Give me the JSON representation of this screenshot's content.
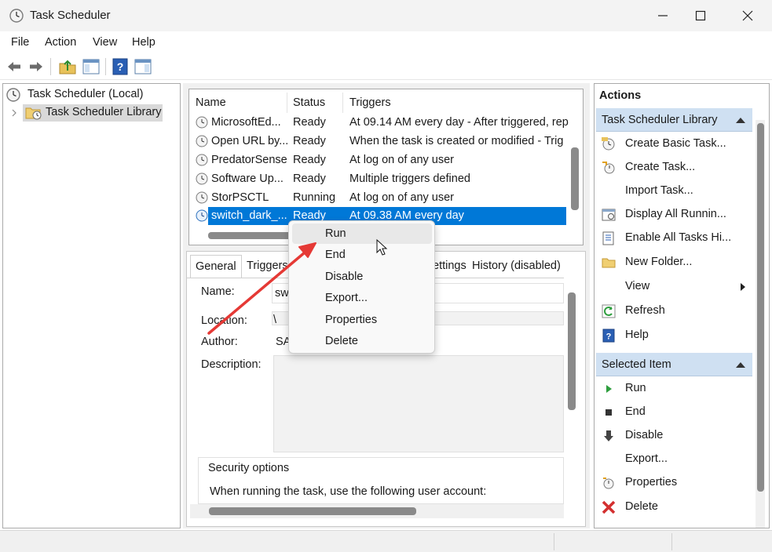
{
  "window": {
    "title": "Task Scheduler"
  },
  "menu": [
    "File",
    "Action",
    "View",
    "Help"
  ],
  "tree": {
    "root": "Task Scheduler (Local)",
    "child": "Task Scheduler Library"
  },
  "task_list": {
    "columns": [
      "Name",
      "Status",
      "Triggers"
    ],
    "rows": [
      {
        "name": "MicrosoftEd...",
        "status": "Ready",
        "trigger": "At 09.14 AM every day - After triggered, rep"
      },
      {
        "name": "Open URL by...",
        "status": "Ready",
        "trigger": "When the task is created or modified - Trig"
      },
      {
        "name": "PredatorSense",
        "status": "Ready",
        "trigger": "At log on of any user"
      },
      {
        "name": "Software Up...",
        "status": "Ready",
        "trigger": "Multiple triggers defined"
      },
      {
        "name": "StorPSCTL",
        "status": "Running",
        "trigger": "At log on of any user"
      },
      {
        "name": "switch_dark_...",
        "status": "Ready",
        "trigger": "At 09.38 AM every day"
      }
    ]
  },
  "detail": {
    "tabs": [
      "General",
      "Triggers",
      "ettings",
      "History (disabled)"
    ],
    "name_label": "Name:",
    "name_value": "sw",
    "location_label": "Location:",
    "location_value": "\\",
    "author_label": "Author:",
    "author_value": "SA",
    "description_label": "Description:",
    "security_label": "Security options",
    "security_text": "When running the task, use the following user account:"
  },
  "context_menu": {
    "items": [
      "Run",
      "End",
      "Disable",
      "Export...",
      "Properties",
      "Delete"
    ],
    "hovered": "Run"
  },
  "actions": {
    "title": "Actions",
    "library_section": "Task Scheduler Library",
    "library_items": [
      {
        "label": "Create Basic Task...",
        "icon": "create-basic-task-icon"
      },
      {
        "label": "Create Task...",
        "icon": "create-task-icon"
      },
      {
        "label": "Import Task...",
        "icon": ""
      },
      {
        "label": "Display All Runnin...",
        "icon": "display-running-icon"
      },
      {
        "label": "Enable All Tasks Hi...",
        "icon": "enable-history-icon"
      },
      {
        "label": "New Folder...",
        "icon": "folder-icon"
      },
      {
        "label": "View",
        "icon": ""
      },
      {
        "label": "Refresh",
        "icon": "refresh-icon"
      },
      {
        "label": "Help",
        "icon": "help-icon"
      }
    ],
    "selected_section": "Selected Item",
    "selected_items": [
      {
        "label": "Run",
        "icon": "run-icon"
      },
      {
        "label": "End",
        "icon": "end-icon"
      },
      {
        "label": "Disable",
        "icon": "disable-icon"
      },
      {
        "label": "Export...",
        "icon": ""
      },
      {
        "label": "Properties",
        "icon": "properties-icon"
      },
      {
        "label": "Delete",
        "icon": "delete-icon"
      }
    ]
  },
  "colors": {
    "selection": "#0078d7",
    "section_header": "#cfe0f2",
    "arrow": "#e53935"
  }
}
